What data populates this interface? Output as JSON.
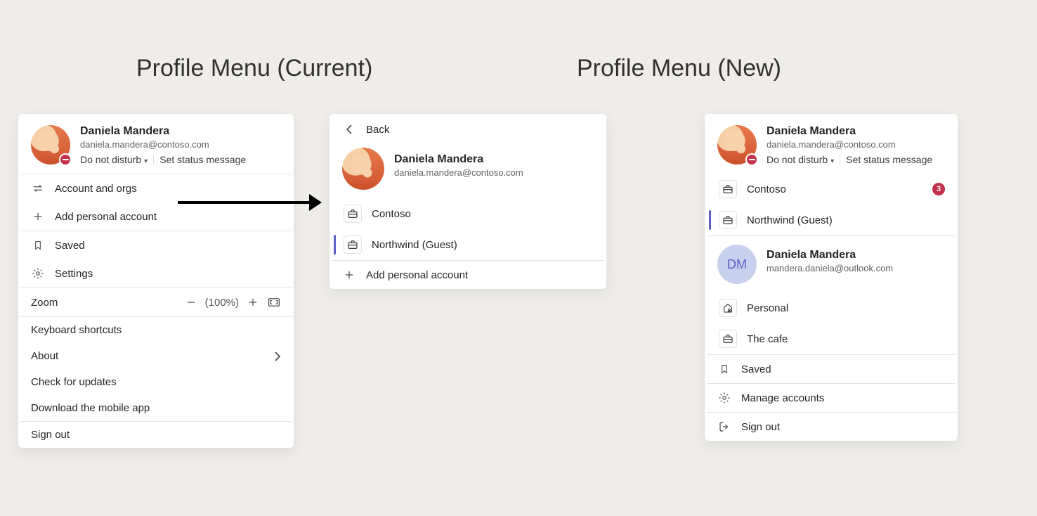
{
  "titles": {
    "left": "Profile Menu (Current)",
    "right": "Profile Menu (New)"
  },
  "user": {
    "name": "Daniela Mandera",
    "email": "daniela.mandera@contoso.com",
    "status": "Do not disturb",
    "set_status": "Set status message"
  },
  "user_alt": {
    "name": "Daniela Mandera",
    "email": "mandera.daniela@outlook.com",
    "initials": "DM"
  },
  "current_menu": {
    "accounts_orgs": "Account and orgs",
    "add_personal": "Add personal account",
    "saved": "Saved",
    "settings": "Settings",
    "zoom_label": "Zoom",
    "zoom_value": "(100%)",
    "shortcuts": "Keyboard shortcuts",
    "about": "About",
    "check_updates": "Check for updates",
    "download_app": "Download the mobile app",
    "sign_out": "Sign out"
  },
  "orgs_panel": {
    "back": "Back",
    "contoso": "Contoso",
    "northwind": "Northwind (Guest)",
    "add_personal": "Add personal account"
  },
  "new_menu": {
    "contoso": "Contoso",
    "contoso_badge": "3",
    "northwind": "Northwind (Guest)",
    "personal": "Personal",
    "cafe": "The cafe",
    "saved": "Saved",
    "manage": "Manage accounts",
    "sign_out": "Sign out"
  }
}
